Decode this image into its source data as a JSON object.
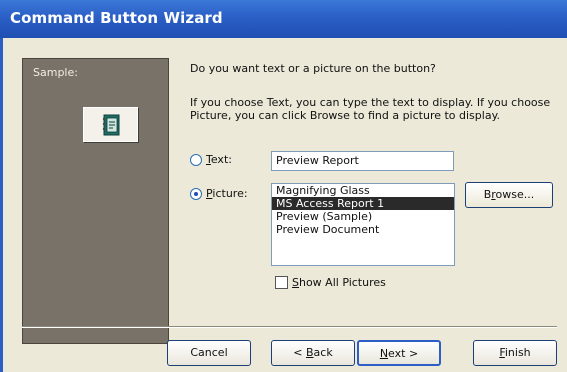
{
  "window": {
    "title": "Command Button Wizard"
  },
  "sample": {
    "label": "Sample:",
    "icon": "report-notebook-icon"
  },
  "prompt": {
    "question": "Do you want text or a picture on the button?",
    "info": "If you choose Text, you can type the text to display.  If you choose Picture, you can click Browse to find a picture to display."
  },
  "text_option": {
    "label_key": "T",
    "label_rest": "ext:",
    "value": "Preview Report",
    "selected": false
  },
  "picture_option": {
    "label_key": "P",
    "label_rest": "icture:",
    "selected": true
  },
  "picture_list": [
    {
      "label": "Magnifying Glass",
      "selected": false
    },
    {
      "label": "MS Access Report 1",
      "selected": true
    },
    {
      "label": "Preview (Sample)",
      "selected": false
    },
    {
      "label": "Preview Document",
      "selected": false
    }
  ],
  "browse_button": {
    "prefix": "B",
    "key": "r",
    "rest": "owse..."
  },
  "show_all": {
    "key": "S",
    "rest": "how All Pictures",
    "checked": false
  },
  "footer": {
    "cancel": "Cancel",
    "back": {
      "prefix": "< ",
      "key": "B",
      "rest": "ack"
    },
    "next": {
      "prefix": "",
      "key": "N",
      "rest": "ext >"
    },
    "finish": {
      "prefix": "",
      "key": "F",
      "rest": "inish"
    }
  },
  "colors": {
    "title_bar": "#2b5fc6",
    "sample_panel": "#797268",
    "selection": "#2a2a2a"
  }
}
